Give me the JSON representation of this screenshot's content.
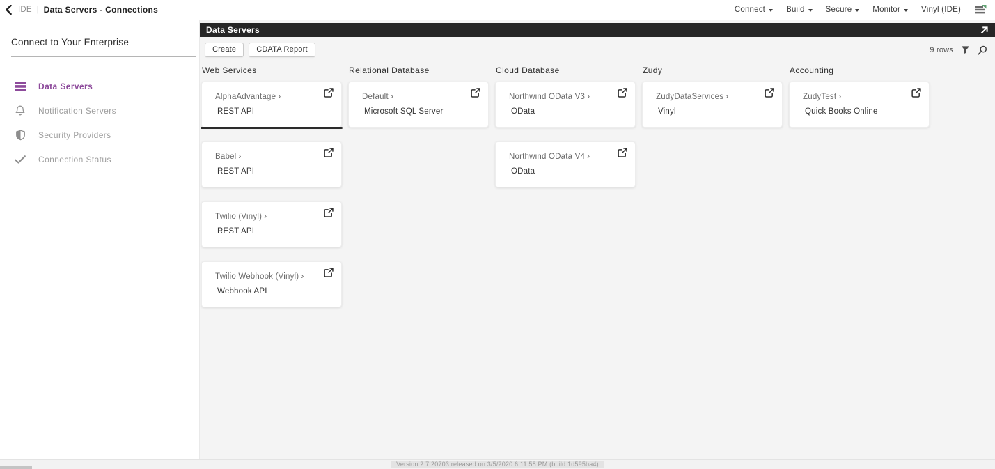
{
  "topbar": {
    "back_icon": "chevron-left-icon",
    "app_label": "IDE",
    "separator": "|",
    "title": "Data Servers - Connections",
    "menus": [
      {
        "label": "Connect",
        "caret": true
      },
      {
        "label": "Build",
        "caret": true
      },
      {
        "label": "Secure",
        "caret": true
      },
      {
        "label": "Monitor",
        "caret": true
      },
      {
        "label": "Vinyl (IDE)",
        "caret": false
      }
    ],
    "logo_icon": "vinyl-logo-icon"
  },
  "sidebar": {
    "heading": "Connect to Your Enterprise",
    "items": [
      {
        "label": "Data Servers",
        "icon": "server-stack-icon",
        "active": true
      },
      {
        "label": "Notification Servers",
        "icon": "bell-icon",
        "active": false
      },
      {
        "label": "Security Providers",
        "icon": "shield-icon",
        "active": false
      },
      {
        "label": "Connection Status",
        "icon": "check-icon",
        "active": false
      }
    ]
  },
  "panel": {
    "title": "Data Servers",
    "expand_icon": "open-fullscreen-icon",
    "card_chevron": "›",
    "card_link_icon": "external-link-icon",
    "toolbar": {
      "create_label": "Create",
      "cdata_report_label": "CDATA Report",
      "row_count": "9 rows",
      "filter_icon": "filter-funnel-icon",
      "search_icon": "search-icon"
    },
    "columns": [
      {
        "header": "Web Services",
        "cards": [
          {
            "title": "AlphaAdvantage",
            "subtitle": "REST API",
            "selected": true
          },
          {
            "title": "Babel",
            "subtitle": "REST API",
            "selected": false
          },
          {
            "title": "Twilio (Vinyl)",
            "subtitle": "REST API",
            "selected": false
          },
          {
            "title": "Twilio Webhook (Vinyl)",
            "subtitle": "Webhook API",
            "selected": false
          }
        ]
      },
      {
        "header": "Relational Database",
        "cards": [
          {
            "title": "Default",
            "subtitle": "Microsoft SQL Server",
            "selected": false
          }
        ]
      },
      {
        "header": "Cloud Database",
        "cards": [
          {
            "title": "Northwind OData V3",
            "subtitle": "OData",
            "selected": false
          },
          {
            "title": "Northwind OData V4",
            "subtitle": "OData",
            "selected": false
          }
        ]
      },
      {
        "header": "Zudy",
        "cards": [
          {
            "title": "ZudyDataServices",
            "subtitle": "Vinyl",
            "selected": false
          }
        ]
      },
      {
        "header": "Accounting",
        "cards": [
          {
            "title": "ZudyTest",
            "subtitle": "Quick Books Online",
            "selected": false
          }
        ]
      }
    ]
  },
  "footer": {
    "version_text": "Version 2.7.20703 released on 3/5/2020 6:11:58 PM (build 1d595ba4)"
  },
  "colors": {
    "accent_purple": "#8d4a9b",
    "panel_header_dark": "#262626",
    "content_background": "#f4f4f4",
    "logo_green": "#63a375"
  }
}
